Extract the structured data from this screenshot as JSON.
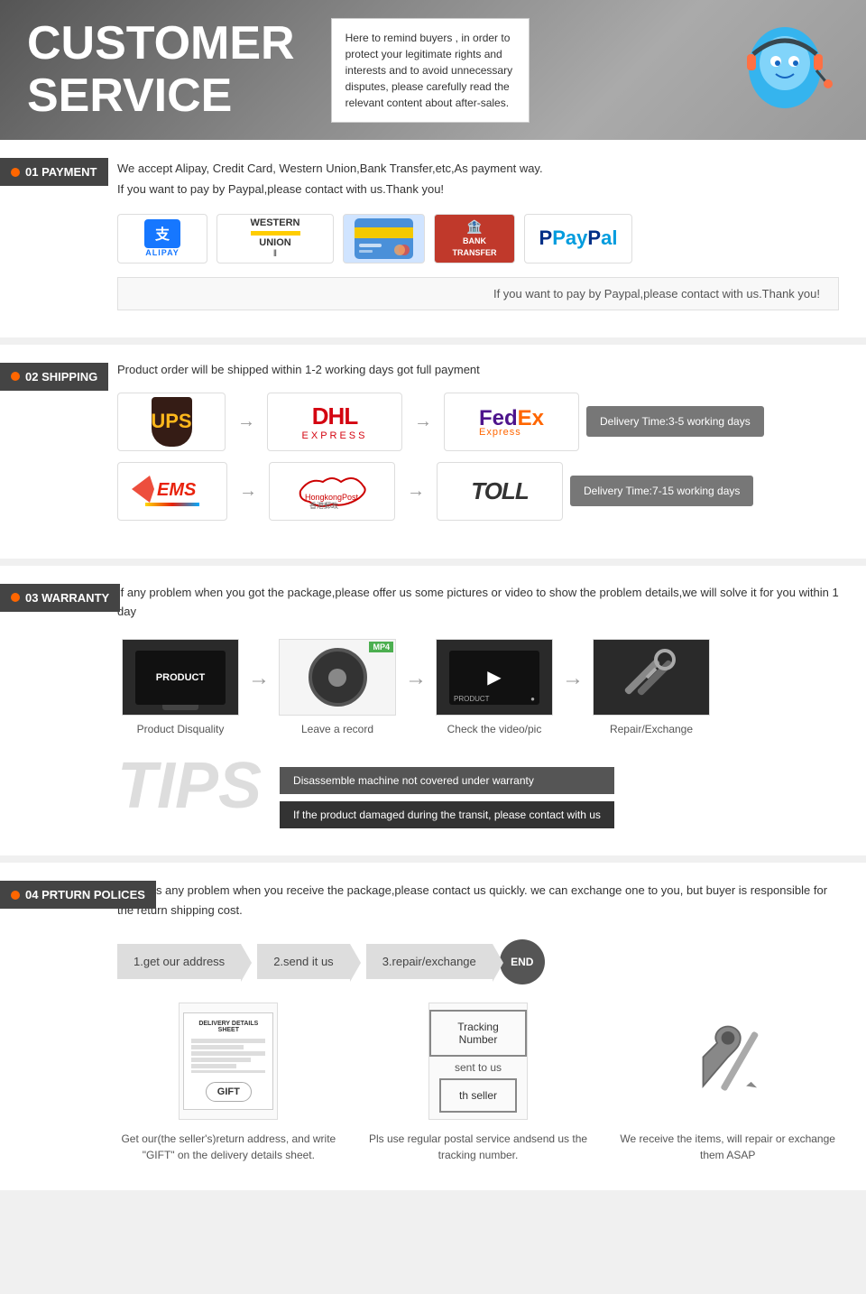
{
  "header": {
    "title_line1": "CUSTOMER",
    "title_line2": "SERVICE",
    "notice": "Here to remind buyers , in order to protect your legitimate rights and interests and to avoid unnecessary disputes, please carefully read the relevant content about after-sales."
  },
  "payment": {
    "section_label": "01 PAYMENT",
    "text1": "We accept Alipay, Credit Card, Western Union,Bank Transfer,etc,As payment way.",
    "text2": "If you want to pay by Paypal,please contact with us.Thank you!",
    "note": "If you want to pay by Paypal,please contact with us.Thank you!",
    "methods": [
      "Alipay",
      "Western Union",
      "Credit Card",
      "Bank Transfer",
      "PayPal"
    ]
  },
  "shipping": {
    "section_label": "02 SHIPPING",
    "text": "Product order will be shipped within 1-2 working days got full payment",
    "carriers_fast": [
      "UPS",
      "DHL Express",
      "FedEx Express"
    ],
    "carriers_slow": [
      "EMS",
      "HongKong Post",
      "TOLL"
    ],
    "delivery_fast": "Delivery Time:3-5 working days",
    "delivery_slow": "Delivery Time:7-15 working days"
  },
  "warranty": {
    "section_label": "03 WARRANTY",
    "text": "If any problem when you got the package,please offer us some pictures or video to show the problem details,we will solve it for you within 1 day",
    "flow": [
      {
        "label": "Product Disquality"
      },
      {
        "label": "Leave a record"
      },
      {
        "label": "Check the video/pic"
      },
      {
        "label": "Repair/Exchange"
      }
    ],
    "tips_word": "TIPS",
    "tip1": "Disassemble machine not covered under warranty",
    "tip2": "If the product damaged during the transit, please contact with us"
  },
  "return": {
    "section_label": "04 PRTURN POLICES",
    "text": "If  there's any problem when you receive the package,please contact us quickly. we can exchange one to you, but buyer is responsible for the return shipping cost.",
    "steps": [
      {
        "label": "1.get our address"
      },
      {
        "label": "2.send it us"
      },
      {
        "label": "3.repair/exchange"
      },
      {
        "label": "END"
      }
    ],
    "items": [
      {
        "desc": "Get our(the seller's)return address, and write \"GIFT\" on the delivery details sheet."
      },
      {
        "tracking_label": "Tracking Number",
        "sent_label": "sent to us",
        "seller_label": "th seller",
        "desc": "Pls use regular postal service andsend us the tracking number."
      },
      {
        "desc": "We receive the items, will repair or exchange them ASAP"
      }
    ]
  }
}
